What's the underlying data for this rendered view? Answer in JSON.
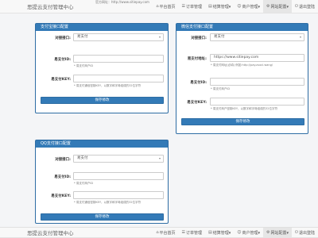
{
  "header": {
    "title": "思提云支付管理中心",
    "url": "官方网址：http://www.sitiepay.com",
    "nav": [
      {
        "icon": "⌂",
        "label": "平台首页"
      },
      {
        "icon": "☰",
        "label": "订单管理"
      },
      {
        "icon": "▤",
        "label": "结算管理▾"
      },
      {
        "icon": "☺",
        "label": "商户管理▾"
      },
      {
        "icon": "⚙",
        "label": "网站配置▾"
      },
      {
        "icon": "⏻",
        "label": "退出登陆"
      }
    ]
  },
  "alipay": {
    "title": "支付宝接口配置",
    "iface_label": "对接接口:",
    "iface_value": "易支付",
    "pid_label": "易支付ID:",
    "pid_hint": "* 易支付商户ID",
    "key_label": "易支付KEY:",
    "key_hint": "* 易支付通信密钥KEY，以数字和字母组成的32位字符",
    "save": "保存修改"
  },
  "wechat": {
    "title": "微信支付接口配置",
    "iface_label": "对接接口:",
    "iface_value": "易支付",
    "url_label": "易支付地址:",
    "url_value": "https://www.sitiepay.com",
    "url_hint": "* 易支付网址(必填) 例如:http://pay.zuoci.wang/",
    "pid_label": "易支付ID:",
    "pid_hint": "* 易支付商户ID",
    "key_label": "易支付KEY:",
    "key_hint": "* 易支付商户密钥KEY，以数字和字母组成的32位字符",
    "save": "保存修改"
  },
  "qq": {
    "title": "QQ支付接口配置",
    "iface_label": "对接接口:",
    "iface_value": "易支付",
    "pid_label": "易支付ID:",
    "pid_hint": "* 易支付商户ID",
    "key_label": "易支付KEY:",
    "key_hint": "* 易支付通信密钥KEY，以数字和字母组成的32位字符",
    "save": "保存修改"
  }
}
